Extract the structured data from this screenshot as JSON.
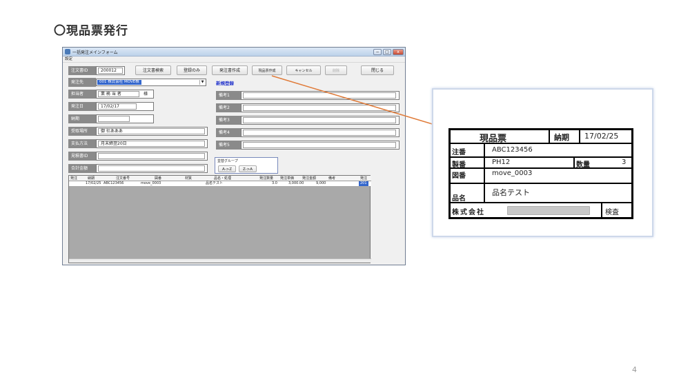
{
  "slide": {
    "title": "〇現品票発行",
    "page_number": "4"
  },
  "window": {
    "title": "一括発注メインフォーム",
    "menu": "設定",
    "controls": {
      "minimize": "−",
      "maximize": "□",
      "close": "x"
    }
  },
  "toolbar": {
    "order_no_label": "注文書ID",
    "order_no_value": "200012",
    "search_label": "注文書検索",
    "register_label": "登録のみ",
    "create_order_label": "発注書作成",
    "issue_tag_label": "現品票作成",
    "cancel_label": "キャンセル",
    "delete_label": "削除",
    "close_label": "閉じる"
  },
  "form": {
    "vendor_label": "発注先",
    "vendor_value": "001 株式会社  MOVE株",
    "section_title": "新規登録",
    "person_label": "担当者",
    "person_value": "業 務 当 者",
    "person_suffix": "様",
    "order_date_label": "発注日",
    "order_date_value": "17/02/17",
    "delivery_label": "納期",
    "delivery_value": "",
    "place_label": "受取場所",
    "place_value": "御  社あああ",
    "payment_label": "支払方法",
    "payment_value": "月末締翌20日",
    "quote_label": "見積書ID",
    "quote_value": "",
    "total_label": "合計金額",
    "total_value": "",
    "notes": [
      "備考1",
      "備考2",
      "備考3",
      "備考4",
      "備考5"
    ]
  },
  "sort": {
    "title": "並替グループ",
    "asc": "A->Z",
    "desc": "Z->A"
  },
  "grid": {
    "columns": [
      "発注",
      "納期",
      "注文番号",
      "図番",
      "材質",
      "品名・処理",
      "発注数量",
      "発注単価",
      "発注金額",
      "備考",
      "発注"
    ],
    "rows": [
      {
        "delivery": "17/02/25",
        "order_no": "ABC123456",
        "drawing": "move_0003",
        "material": "",
        "item": "品名テスト",
        "qty": "3.0",
        "price": "3,000.00",
        "amount": "9,000",
        "note": "",
        "flag": "201"
      }
    ]
  },
  "tag": {
    "title": "現品票",
    "delivery_label": "納期",
    "delivery_value": "17/02/25",
    "order_label": "注番",
    "order_value": "ABC123456",
    "product_label": "製番",
    "product_value": "PH12",
    "qty_label": "数量",
    "qty_value": "3",
    "drawing_label": "図番",
    "drawing_value": "move_0003",
    "item_label": "品名",
    "item_value": "品名テスト",
    "company_label": "株式会社",
    "inspect_label": "検査"
  },
  "colors": {
    "accent_arrow": "#e07b39",
    "selection": "#3366cc",
    "section_title": "#2233cc"
  }
}
